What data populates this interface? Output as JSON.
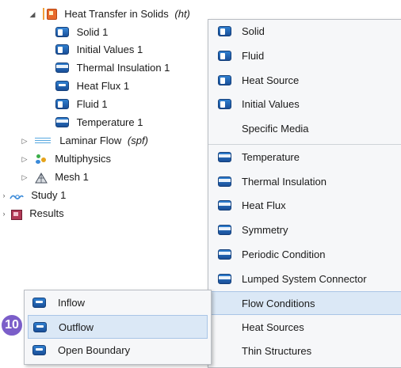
{
  "tree": {
    "heat_transfer": {
      "label": "Heat Transfer in Solids",
      "tag": "(ht)"
    },
    "children": [
      "Solid 1",
      "Initial Values 1",
      "Thermal Insulation 1",
      "Heat Flux 1",
      "Fluid 1",
      "Temperature 1"
    ],
    "laminar_flow": {
      "label": "Laminar Flow",
      "tag": "(spf)"
    },
    "multiphysics": "Multiphysics",
    "mesh": "Mesh 1",
    "study": "Study 1",
    "results": "Results"
  },
  "context_menu": {
    "group1": [
      "Solid",
      "Fluid",
      "Heat Source",
      "Initial Values",
      "Specific Media"
    ],
    "group2": [
      "Temperature",
      "Thermal Insulation",
      "Heat Flux",
      "Symmetry",
      "Periodic Condition",
      "Lumped System Connector",
      "Flow Conditions",
      "Heat Sources",
      "Thin Structures"
    ]
  },
  "submenu": {
    "items": [
      "Inflow",
      "Outflow",
      "Open Boundary"
    ],
    "highlighted": "Outflow"
  },
  "step_badge": "10",
  "colors": {
    "accent": "#2f7fd0",
    "highlight": "#dbe8f6",
    "badge": "#7b5ec9"
  }
}
